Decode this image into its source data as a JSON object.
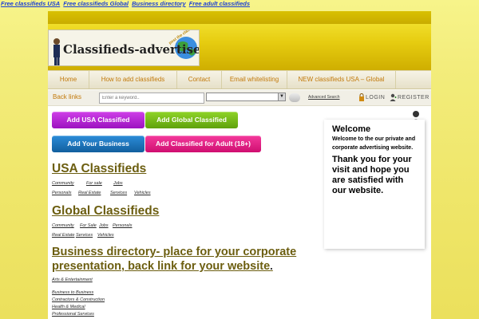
{
  "top_links": [
    {
      "label": "Free classifieds USA"
    },
    {
      "label": "Free classifieds Global"
    },
    {
      "label": "Business directory"
    },
    {
      "label": "Free adult classifieds"
    }
  ],
  "logo": {
    "text": "Classifieds-advertisement.com",
    "slogan": "post the classifieds ads"
  },
  "nav": [
    {
      "label": "Home"
    },
    {
      "label": "How to add classifieds"
    },
    {
      "label": "Contact"
    },
    {
      "label": "Email whitelisting"
    },
    {
      "label": "NEW classifieds USA – Global"
    }
  ],
  "search": {
    "back_links": "Back links",
    "placeholder": "Enter a keyword..",
    "advanced": "Advanced Search",
    "login": "LOGIN",
    "register": "REGISTER"
  },
  "buttons": {
    "add_usa": "Add USA Classified",
    "add_global": "Add Global Classified",
    "add_business": "Add Your Business",
    "add_adult": "Add Classified for Adult (18+)"
  },
  "usa": {
    "title": "USA Classifieds",
    "cats": [
      "Community",
      "For sale",
      "Jobs",
      "Personals",
      "Real Estate",
      "Services",
      "Vehicles"
    ]
  },
  "global": {
    "title": "Global Classifieds",
    "cats": [
      "Community",
      "For Sale",
      "Jobs",
      "Personals",
      "Real Estate",
      "Services",
      "Vehicles"
    ]
  },
  "business": {
    "title": "Business directory- place for your corporate presentation, back link for your website",
    "cats": [
      "Arts & Entertainment",
      "Business to Business",
      "Contractors & Construction",
      "Health & Medical",
      "Professional Services"
    ]
  },
  "welcome": {
    "title": "Welcome",
    "text": "Welcome to the our private and corporate advertising website.",
    "thanks": "Thank you for your visit and hope you are satisfied with our website."
  },
  "colors": {
    "accent_gold": "#d9c000",
    "nav_text": "#c2790a",
    "heading_text": "#6c5e10"
  }
}
